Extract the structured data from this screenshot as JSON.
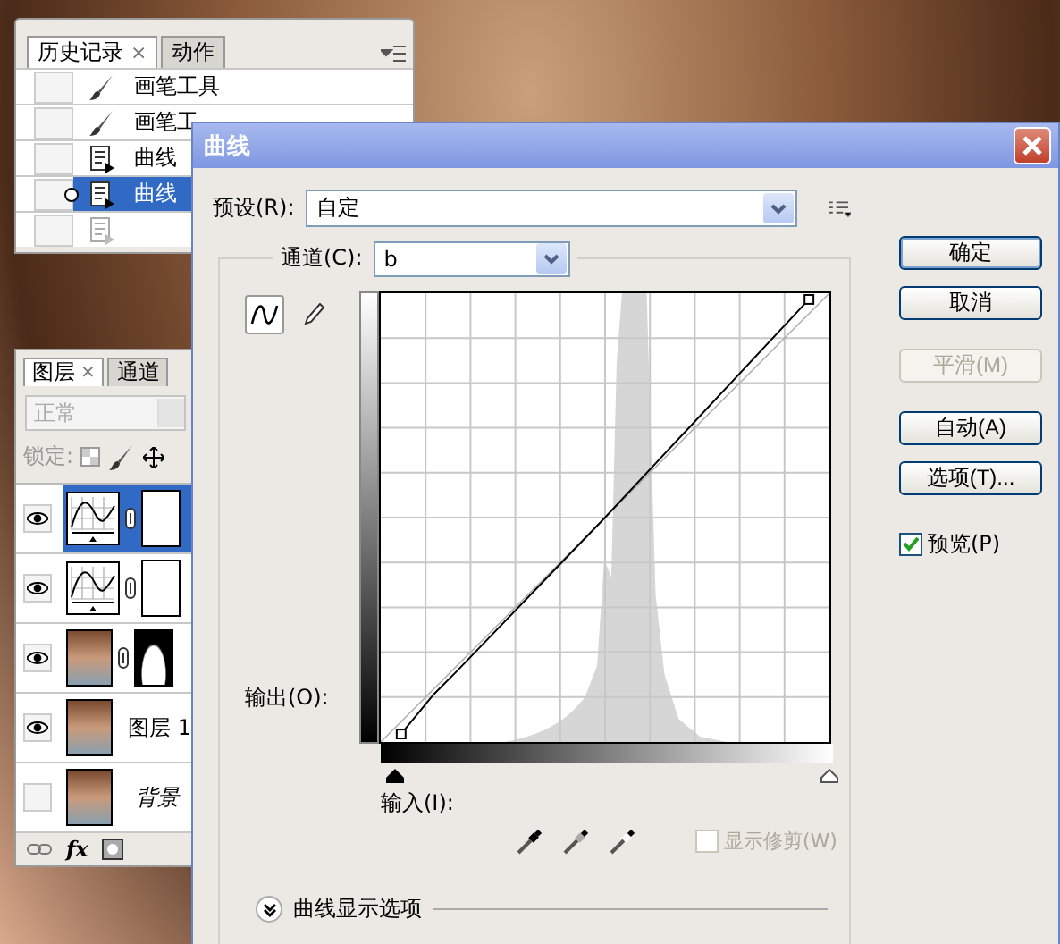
{
  "history_panel": {
    "tabs": [
      {
        "label": "历史记录",
        "selected": true
      },
      {
        "label": "动作",
        "selected": false
      }
    ],
    "tab_close": "×",
    "items": [
      {
        "label": "画笔工具",
        "kind": "brush",
        "selected": false,
        "snapshot": false
      },
      {
        "label": "画笔工",
        "kind": "brush",
        "selected": false,
        "snapshot": false
      },
      {
        "label": "曲线",
        "kind": "adjustment",
        "selected": false,
        "snapshot": false
      },
      {
        "label": "曲线",
        "kind": "adjustment",
        "selected": true,
        "snapshot": false
      },
      {
        "kind": "adjustment",
        "disabled": true,
        "selected": false,
        "snapshot": false
      }
    ]
  },
  "layers_panel": {
    "tabs": [
      {
        "label": "图层",
        "selected": true
      },
      {
        "label": "通道",
        "selected": false
      }
    ],
    "tab_close": "×",
    "blend_mode": "正常",
    "lock_label": "锁定:",
    "fx_label": "fx",
    "layers": [
      {
        "kind": "curves",
        "visible": true,
        "selected": true
      },
      {
        "kind": "curves",
        "visible": true,
        "selected": false
      },
      {
        "kind": "masked_photo",
        "visible": true,
        "selected": false
      },
      {
        "kind": "photo",
        "name": "图层 1",
        "visible": true,
        "selected": false
      },
      {
        "kind": "background",
        "name": "背景",
        "visible": false,
        "selected": false
      }
    ]
  },
  "dialog": {
    "title": "曲线",
    "preset": {
      "label": "预设(R):",
      "value": "自定"
    },
    "channel": {
      "label": "通道(C):",
      "value": "b"
    },
    "curve_tools": [
      {
        "kind": "curve",
        "selected": true
      },
      {
        "kind": "pencil",
        "selected": false
      }
    ],
    "output_label": "输出(O):",
    "input_label": "输入(I):",
    "show_clipping": {
      "label": "显示修剪(W)",
      "checked": false,
      "disabled": true
    },
    "display_options": {
      "label": "曲线显示选项",
      "expanded": false
    },
    "buttons": [
      {
        "label": "确定",
        "default": true,
        "disabled": false
      },
      {
        "label": "取消",
        "default": false,
        "disabled": false
      },
      {
        "label": "平滑(M)",
        "default": false,
        "disabled": true
      },
      {
        "label": "自动(A)",
        "default": false,
        "disabled": false
      },
      {
        "label": "选项(T)...",
        "default": false,
        "disabled": false
      }
    ],
    "preview": {
      "label": "预览(P)",
      "checked": true
    }
  }
}
